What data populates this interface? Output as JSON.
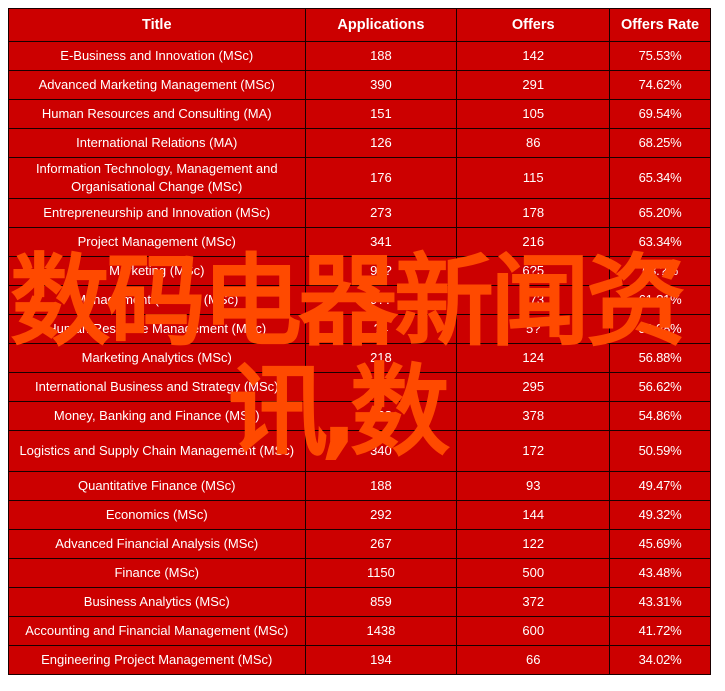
{
  "table": {
    "headers": [
      "Title",
      "Applications",
      "Offers",
      "Offers  Rate"
    ],
    "rows": [
      {
        "title": "E-Business and Innovation (MSc)",
        "applications": "188",
        "offers": "142",
        "rate": "75.53%"
      },
      {
        "title": "Advanced Marketing Management (MSc)",
        "applications": "390",
        "offers": "291",
        "rate": "74.62%"
      },
      {
        "title": "Human Resources and Consulting (MA)",
        "applications": "151",
        "offers": "105",
        "rate": "69.54%"
      },
      {
        "title": "International Relations (MA)",
        "applications": "126",
        "offers": "86",
        "rate": "68.25%"
      },
      {
        "title": "Information Technology, Management and Organisational Change (MSc)",
        "applications": "176",
        "offers": "115",
        "rate": "65.34%",
        "tall": true
      },
      {
        "title": "Entrepreneurship and Innovation (MSc)",
        "applications": "273",
        "offers": "178",
        "rate": "65.20%"
      },
      {
        "title": "Project Management (MSc)",
        "applications": "341",
        "offers": "216",
        "rate": "63.34%"
      },
      {
        "title": "Marketing (MSc)",
        "applications": "9??",
        "offers": "6?5",
        "rate": "63.?%"
      },
      {
        "title": "Management (1 Year) (MSc)",
        "applications": "9??",
        "offers": "?73",
        "rate": "61.?1%"
      },
      {
        "title": "Human Resource Management (MSc)",
        "applications": "?4",
        "offers": "5?",
        "rate": "59.?8%"
      },
      {
        "title": "Marketing Analytics (MSc)",
        "applications": "218",
        "offers": "124",
        "rate": "56.88%"
      },
      {
        "title": "International Business and Strategy (MSc)",
        "applications": "5?1",
        "offers": "295",
        "rate": "56.62%"
      },
      {
        "title": "Money, Banking and Finance (MSc)",
        "applications": "6??",
        "offers": "378",
        "rate": "54.86%"
      },
      {
        "title": "Logistics and Supply Chain Management (MSc)",
        "applications": "340",
        "offers": "172",
        "rate": "50.59%",
        "tall": true
      },
      {
        "title": "Quantitative Finance (MSc)",
        "applications": "188",
        "offers": "93",
        "rate": "49.47%"
      },
      {
        "title": "Economics (MSc)",
        "applications": "292",
        "offers": "144",
        "rate": "49.32%"
      },
      {
        "title": "Advanced Financial Analysis (MSc)",
        "applications": "267",
        "offers": "122",
        "rate": "45.69%"
      },
      {
        "title": "Finance (MSc)",
        "applications": "1150",
        "offers": "500",
        "rate": "43.48%"
      },
      {
        "title": "Business Analytics (MSc)",
        "applications": "859",
        "offers": "372",
        "rate": "43.31%"
      },
      {
        "title": "Accounting and Financial Management (MSc)",
        "applications": "1438",
        "offers": "600",
        "rate": "41.72%"
      },
      {
        "title": "Engineering Project Management (MSc)",
        "applications": "194",
        "offers": "66",
        "rate": "34.02%"
      }
    ]
  },
  "watermark": {
    "line1": "数码电器新闻资",
    "line2": "讯,数",
    "color": "#ff4a00"
  },
  "colors": {
    "table_background": "#cc0000",
    "text": "#ffffff",
    "border": "#1a0000"
  }
}
